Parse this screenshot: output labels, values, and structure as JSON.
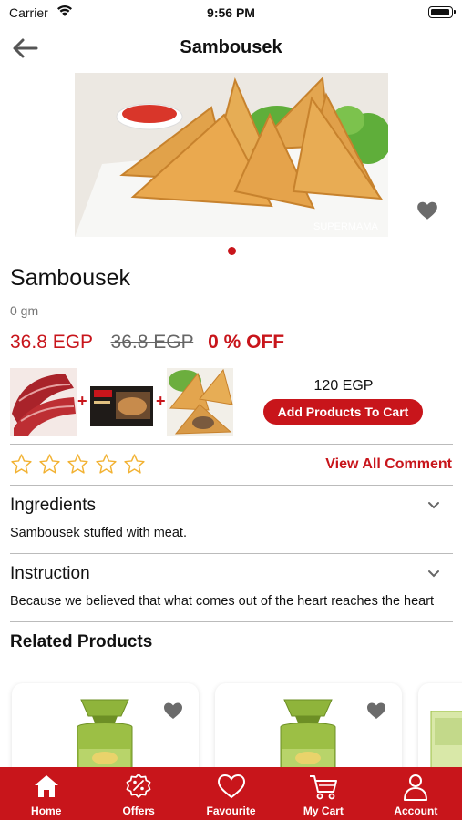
{
  "status_bar": {
    "carrier": "Carrier",
    "time": "9:56 PM"
  },
  "header": {
    "title": "Sambousek",
    "back_icon": "arrow-left-icon"
  },
  "product": {
    "name": "Sambousek",
    "weight": "0 gm",
    "price": "36.8 EGP",
    "old_price": "36.8 EGP",
    "discount": "0 % OFF",
    "image_watermark": "SUPERMAMA",
    "gallery_pages": 1,
    "gallery_current": 1
  },
  "bundle": {
    "items": [
      "sliced-basterma",
      "boxed-burger",
      "sambousek-plate"
    ],
    "price": "120 EGP",
    "button_label": "Add Products To Cart"
  },
  "rating": {
    "stars_filled": 0,
    "stars_total": 5,
    "view_all_label": "View All Comment"
  },
  "ingredients": {
    "title": "Ingredients",
    "text": "Sambousek stuffed with meat."
  },
  "instruction": {
    "title": "Instruction",
    "text": "Because we believed that what comes out of the heart reaches the heart"
  },
  "related": {
    "title": "Related Products"
  },
  "tabs": [
    {
      "label": "Home",
      "icon": "home-icon"
    },
    {
      "label": "Offers",
      "icon": "offers-badge-icon"
    },
    {
      "label": "Favourite",
      "icon": "heart-outline-icon"
    },
    {
      "label": "My Cart",
      "icon": "cart-icon"
    },
    {
      "label": "Account",
      "icon": "user-icon"
    }
  ],
  "colors": {
    "brand": "#c8151b",
    "star": "#f2b233",
    "favourite_icon": "#6b6b6b"
  }
}
